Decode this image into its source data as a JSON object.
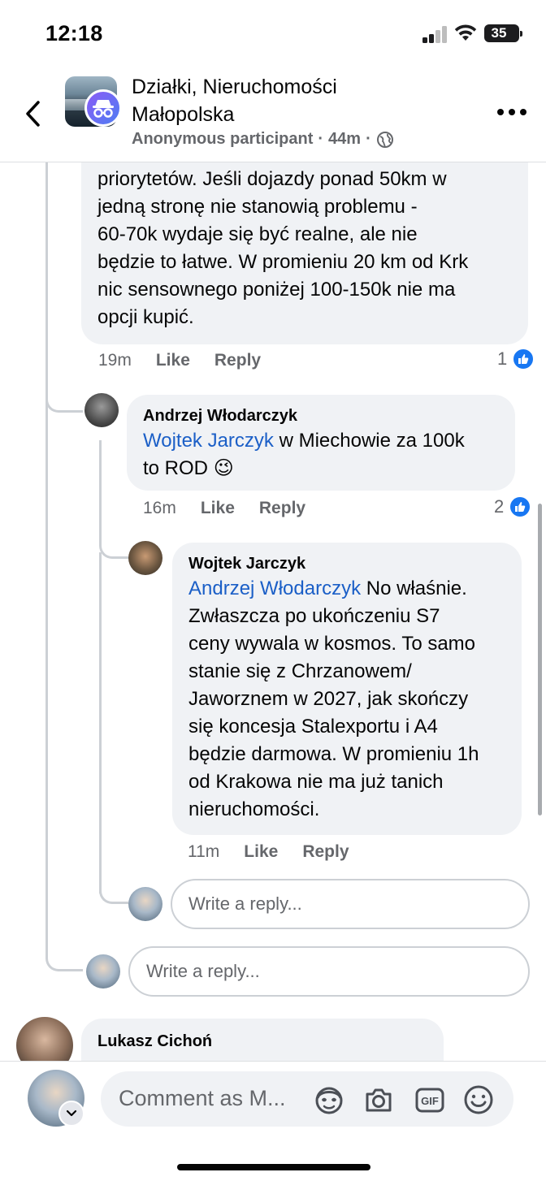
{
  "status_bar": {
    "time": "12:18",
    "battery": "35"
  },
  "header": {
    "group_name_line1": "Działki, Nieruchomości",
    "group_name_line2": "Małopolska",
    "author": "Anonymous participant",
    "age": "44m",
    "separator": "·",
    "privacy_icon": "globe-icon"
  },
  "comments": {
    "top": {
      "text_lines": [
        "priorytetów. Jeśli dojazdy ponad 50km w",
        "jedną stronę nie stanowią problemu -",
        "60-70k wydaje się być realne, ale nie",
        "będzie to łatwe. W promieniu 20 km od Krk",
        "nic sensownego poniżej 100-150k nie ma",
        "opcji kupić."
      ],
      "time": "19m",
      "like": "Like",
      "reply": "Reply",
      "reactions": "1"
    },
    "andrzej": {
      "author": "Andrzej Włodarczyk",
      "mention": "Wojtek Jarczyk",
      "text_after_mention": " w Miechowie za 100k",
      "text_line2": "to ROD ",
      "emoji": "😉",
      "time": "16m",
      "like": "Like",
      "reply": "Reply",
      "reactions": "2"
    },
    "wojtek": {
      "author": "Wojtek Jarczyk",
      "mention": "Andrzej Włodarczyk",
      "text_after_mention": " No właśnie.",
      "text_lines": [
        "Zwłaszcza po ukończeniu S7",
        "ceny wywala w kosmos. To samo",
        "stanie się z Chrzanowem/",
        "Jaworznem w 2027, jak skończy",
        "się koncesja Stalexportu i A4",
        "będzie darmowa. W promieniu 1h",
        "od Krakowa nie ma już tanich",
        "nieruchomości."
      ],
      "time": "11m",
      "like": "Like",
      "reply": "Reply"
    },
    "lukasz": {
      "author": "Lukasz Cichoń"
    }
  },
  "reply_inputs": {
    "nested_placeholder": "Write a reply...",
    "outer_placeholder": "Write a reply..."
  },
  "composer": {
    "placeholder": "Comment as M...",
    "icons": [
      "avatar-sticker-icon",
      "camera-icon",
      "gif-icon",
      "emoji-icon"
    ]
  },
  "colors": {
    "accent": "#1877f2",
    "mention": "#1b5fc7",
    "bubble": "#f0f2f5",
    "secondary_text": "#65676b"
  }
}
